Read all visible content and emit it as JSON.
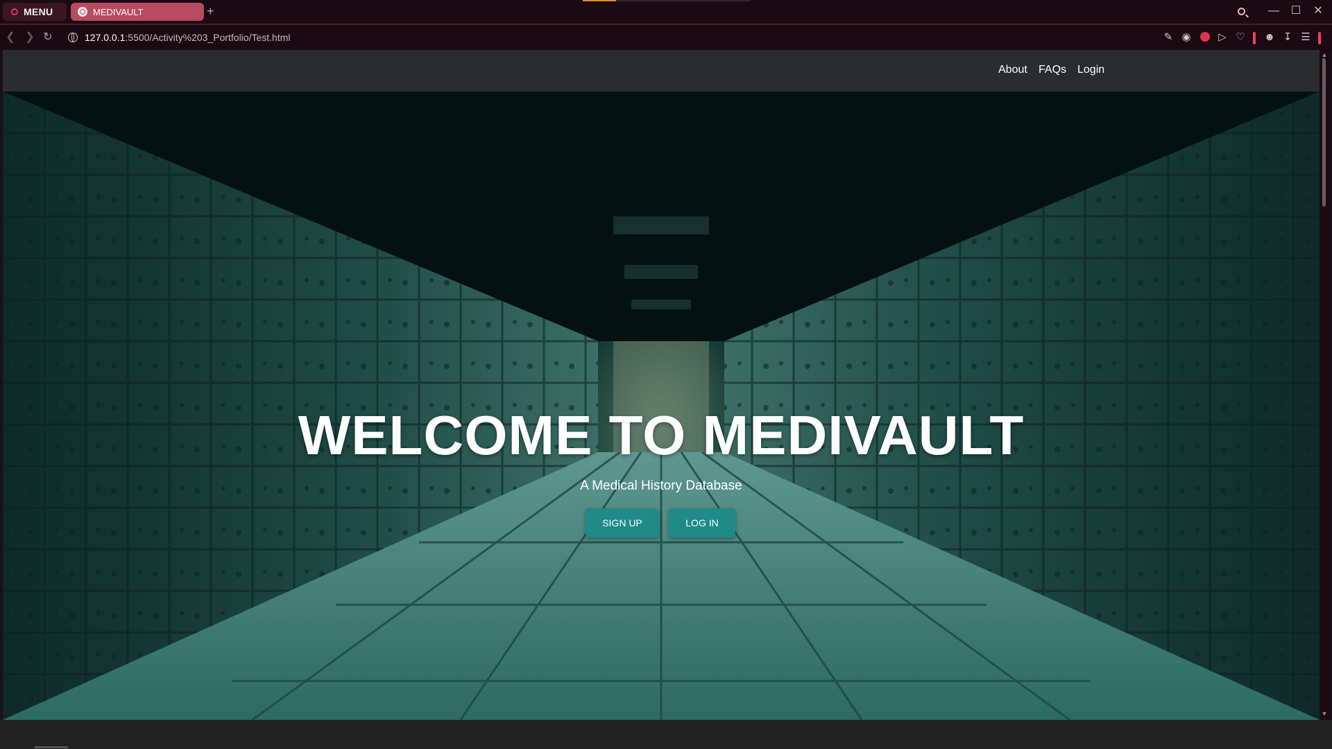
{
  "browser": {
    "menu_label": "MENU",
    "tab_title": "MEDIVAULT",
    "new_tab_symbol": "+",
    "url_host": "127.0.0.1",
    "url_rest": ":5500/Activity%203_Portfolio/Test.html",
    "icons": [
      "back-icon",
      "forward-icon",
      "reload-icon",
      "site-info-icon",
      "snapshot-edit-icon",
      "camera-icon",
      "shield-icon",
      "send-icon",
      "heart-icon",
      "account-icon",
      "download-icon",
      "easy-setup-icon"
    ],
    "accent_color": "#b84a62"
  },
  "site": {
    "nav": {
      "about": "About",
      "faqs": "FAQs",
      "login": "Login"
    },
    "hero": {
      "title": "WELCOME TO MEDIVAULT",
      "subtitle": "A Medical History Database",
      "signup_label": "SIGN UP",
      "login_label": "LOG IN"
    },
    "button_color": "#1f8a88",
    "nav_color": "#2a2c2e"
  }
}
